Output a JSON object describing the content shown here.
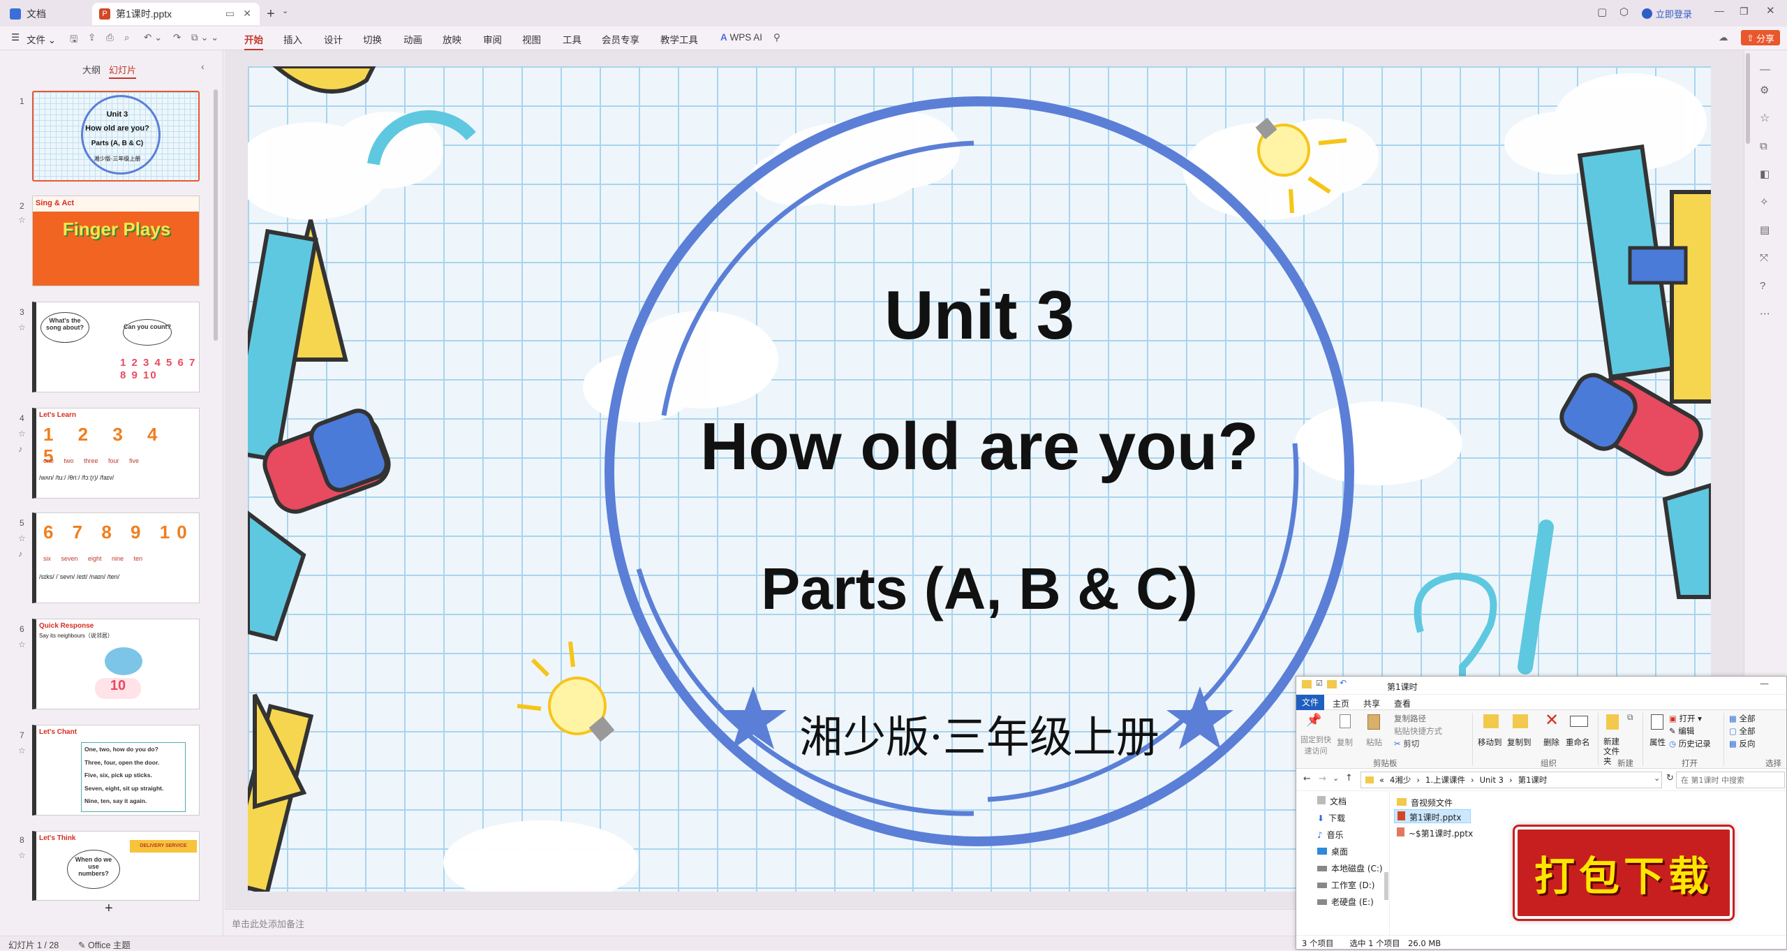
{
  "titlebar": {
    "tab_home": "文档",
    "tab_file": "第1课时.pptx",
    "login": "立即登录"
  },
  "menubar": {
    "file": "文件",
    "items": [
      "开始",
      "插入",
      "设计",
      "切换",
      "动画",
      "放映",
      "审阅",
      "视图",
      "工具",
      "会员专享",
      "教学工具"
    ],
    "wps_ai": "WPS AI",
    "share": "分享"
  },
  "leftpanel": {
    "tab_outline": "大纲",
    "tab_slides": "幻灯片",
    "add": "+",
    "thumbs": [
      {
        "num": "1",
        "lines": [
          "Unit 3",
          "How old are you?",
          "Parts (A, B & C)",
          "湘少版·三年级上册"
        ]
      },
      {
        "num": "2",
        "tag": "Sing & Act",
        "big": "Finger Plays"
      },
      {
        "num": "3",
        "b1": "What's the song about?",
        "b2": "Can you count?",
        "nums": "1 2 3 4 5 6 7 8 9 10"
      },
      {
        "num": "4",
        "tag": "Let's Learn",
        "digits": "1 2 3 4 5",
        "words": "one two three four five",
        "ipa": "/wʌn/ /tuː/ /θriː/ /fɔː(r)/ /faɪv/"
      },
      {
        "num": "5",
        "digits": "6 7 8 9 10",
        "words": "six seven eight nine ten",
        "ipa": "/sɪks/ /ˈsevn/ /eɪt/ /naɪn/ /ten/"
      },
      {
        "num": "6",
        "tag": "Quick Response",
        "sub": "Say its neighbours（说邻居）",
        "card": "10"
      },
      {
        "num": "7",
        "tag": "Let's Chant",
        "chant": [
          "One, two, how do you do?",
          "Three, four, open the door.",
          "Five, six, pick up sticks.",
          "Seven, eight, sit up straight.",
          "Nine, ten, say it again."
        ]
      },
      {
        "num": "8",
        "tag": "Let's Think",
        "bubble": "When do we use numbers?",
        "banner": "DELIVERY SERVICE"
      }
    ]
  },
  "slide": {
    "title": "Unit 3",
    "subtitle": "How old are you?",
    "parts": "Parts (A, B & C)",
    "publisher": "湘少版·三年级上册"
  },
  "notes_placeholder": "单击此处添加备注",
  "status": {
    "slide_count": "幻灯片 1 / 28",
    "theme": "Office 主题"
  },
  "explorer": {
    "title": "第1课时",
    "ribbon_tabs": [
      "文件",
      "主页",
      "共享",
      "查看"
    ],
    "pin": "固定到快速访问",
    "copy": "复制",
    "paste": "粘贴",
    "copy_path": "复制路径",
    "paste_shortcut": "粘贴快捷方式",
    "cut": "剪切",
    "move_to": "移动到",
    "copy_to": "复制到",
    "delete": "删除",
    "rename": "重命名",
    "new_folder": "新建文件夹",
    "properties": "属性",
    "open": "打开",
    "edit": "编辑",
    "history": "历史记录",
    "select_all": "全部",
    "select_none": "全部",
    "invert": "反向",
    "group_clipboard": "剪贴板",
    "group_organize": "组织",
    "group_new": "新建",
    "group_open": "打开",
    "group_select": "选择",
    "path": [
      "«",
      "4湘少",
      "1.上课课件",
      "Unit 3",
      "第1课时"
    ],
    "search_placeholder": "在 第1课时 中搜索",
    "nav_items": [
      "文档",
      "下载",
      "音乐",
      "桌面",
      "本地磁盘 (C:)",
      "工作室 (D:)",
      "老硬盘 (E:)"
    ],
    "files": [
      "音视频文件",
      "第1课时.pptx",
      "~$第1课时.pptx"
    ],
    "status": "3 个项目　　选中 1 个项目　26.0 MB",
    "download_banner": "打包下载"
  },
  "colors": {
    "accent": "#c0392b",
    "circle": "#5b7fd6",
    "grid": "#a9d4ee"
  }
}
